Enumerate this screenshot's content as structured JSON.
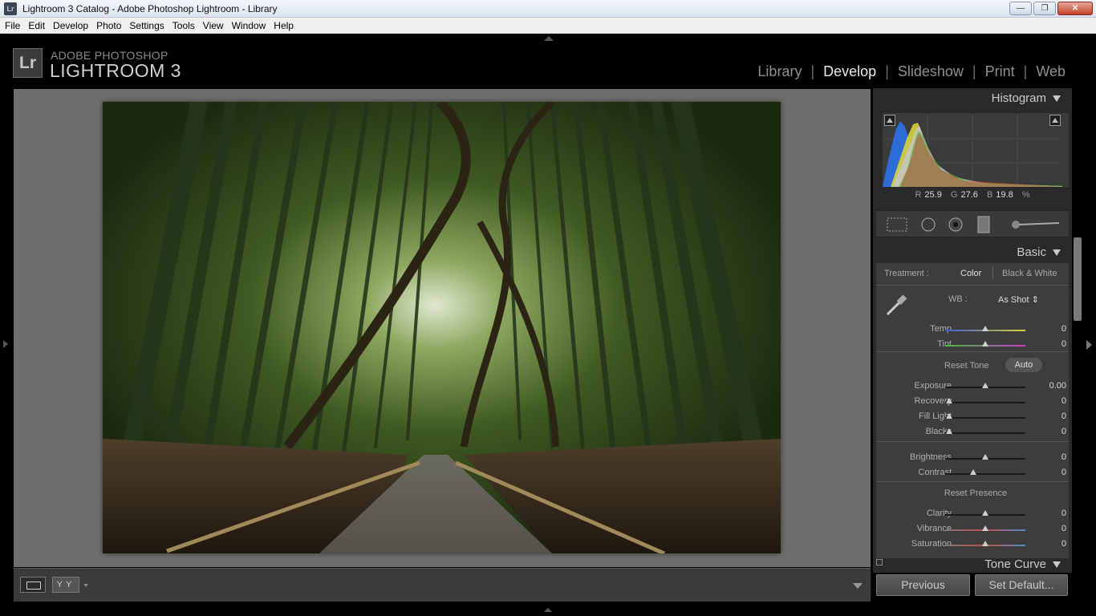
{
  "window": {
    "title": "Lightroom 3 Catalog - Adobe Photoshop Lightroom - Library",
    "app_icon_text": "Lr",
    "minimize": "—",
    "restore": "❐",
    "close": "✕"
  },
  "menu": [
    "File",
    "Edit",
    "Develop",
    "Photo",
    "Settings",
    "Tools",
    "View",
    "Window",
    "Help"
  ],
  "identity": {
    "badge": "Lr",
    "brand_top": "ADOBE PHOTOSHOP",
    "brand_main": "LIGHTROOM 3"
  },
  "modules": [
    {
      "label": "Library",
      "active": false
    },
    {
      "label": "Develop",
      "active": true
    },
    {
      "label": "Slideshow",
      "active": false
    },
    {
      "label": "Print",
      "active": false
    },
    {
      "label": "Web",
      "active": false
    }
  ],
  "histogram": {
    "title": "Histogram",
    "r_label": "R",
    "r_value": "25.9",
    "g_label": "G",
    "g_value": "27.6",
    "b_label": "B",
    "b_value": "19.8",
    "unit": "%"
  },
  "basic": {
    "title": "Basic",
    "treatment_label": "Treatment :",
    "treatment_color": "Color",
    "treatment_bw": "Black & White",
    "wb_label": "WB :",
    "wb_value": "As Shot ⇕",
    "reset_tone": "Reset Tone",
    "auto": "Auto",
    "reset_presence": "Reset Presence",
    "sliders": [
      {
        "label": "Temp",
        "value": "0",
        "pos": 0.5
      },
      {
        "label": "Tint",
        "value": "0",
        "pos": 0.5
      },
      {
        "label": "Exposure",
        "value": "0.00",
        "pos": 0.5
      },
      {
        "label": "Recovery",
        "value": "0",
        "pos": 0.05
      },
      {
        "label": "Fill Light",
        "value": "0",
        "pos": 0.05
      },
      {
        "label": "Blacks",
        "value": "0",
        "pos": 0.05
      },
      {
        "label": "Brightness",
        "value": "0",
        "pos": 0.5
      },
      {
        "label": "Contrast",
        "value": "0",
        "pos": 0.35
      },
      {
        "label": "Clarity",
        "value": "0",
        "pos": 0.5
      },
      {
        "label": "Vibrance",
        "value": "0",
        "pos": 0.5
      },
      {
        "label": "Saturation",
        "value": "0",
        "pos": 0.5
      }
    ]
  },
  "tone_curve": {
    "title": "Tone Curve"
  },
  "buttons": {
    "previous": "Previous",
    "set_default": "Set Default..."
  },
  "toolbar": {
    "yy": "YY"
  }
}
